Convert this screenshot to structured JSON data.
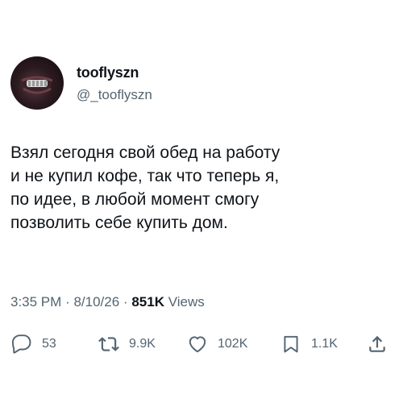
{
  "user": {
    "display_name": "tooflyszn",
    "handle": "@_tooflyszn"
  },
  "tweet": {
    "text": "Взял сегодня свой обед на работу\nи не купил кофе, так что теперь я,\nпо идее, в любой момент смогу\nпозволить себе купить дом.",
    "time": "3:35 PM",
    "date": "8/10/26",
    "separator": "·",
    "views_count": "851K",
    "views_label": "Views"
  },
  "actions": {
    "replies": "53",
    "reposts": "9.9K",
    "likes": "102K",
    "bookmarks": "1.1K"
  },
  "icons": [
    "reply-icon",
    "repost-icon",
    "like-icon",
    "bookmark-icon",
    "share-icon"
  ],
  "colors": {
    "text": "#0f1419",
    "secondary": "#536471",
    "background": "#ffffff"
  }
}
